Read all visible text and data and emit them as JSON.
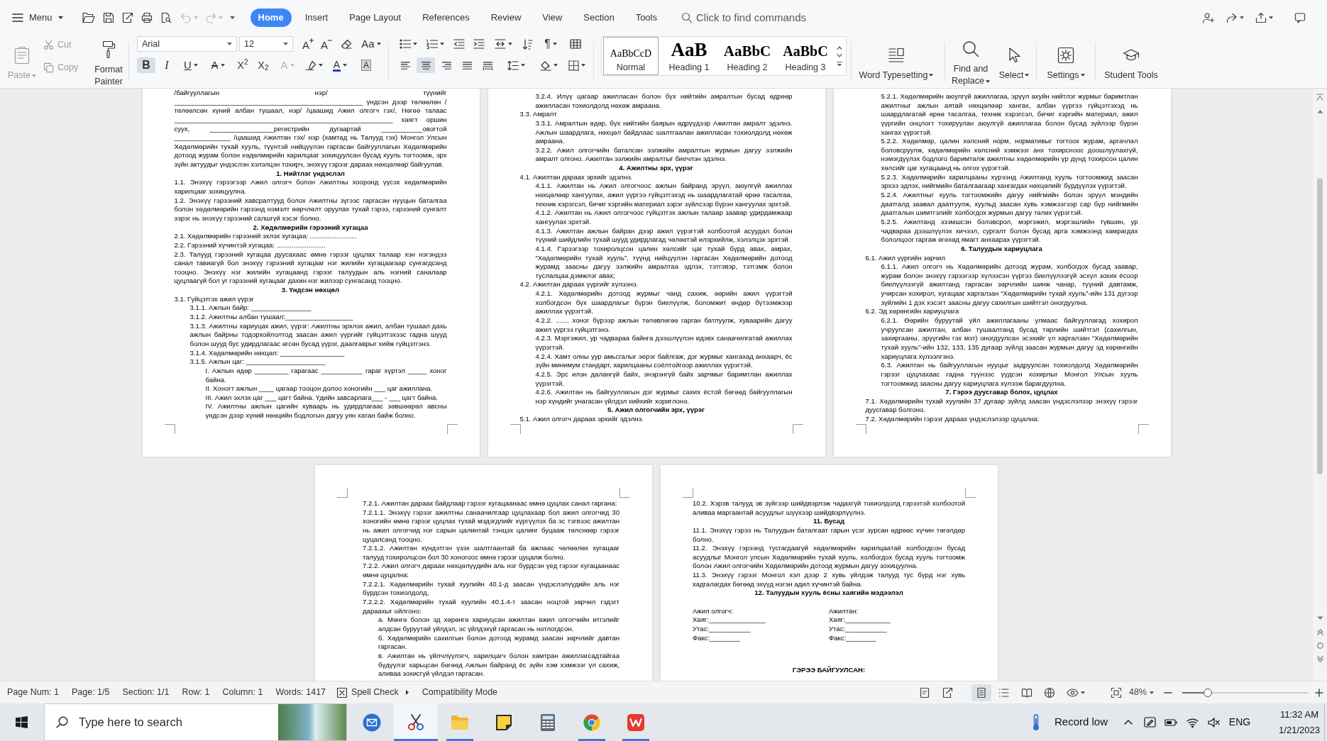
{
  "title_bar": {
    "menu": "Menu",
    "history": [
      {
        "kind": "undo",
        "disabled": true
      },
      {
        "kind": "redo",
        "disabled": true
      }
    ],
    "tabs": [
      {
        "label": "Home",
        "selected": true
      },
      {
        "label": "Insert",
        "selected": false
      },
      {
        "label": "Page Layout",
        "selected": false
      },
      {
        "label": "References",
        "selected": false
      },
      {
        "label": "Review",
        "selected": false
      },
      {
        "label": "View",
        "selected": false
      },
      {
        "label": "Section",
        "selected": false
      },
      {
        "label": "Tools",
        "selected": false
      }
    ],
    "search": {
      "placeholder": "Click to find commands"
    }
  },
  "ribbon": {
    "clipboard": [
      {
        "kind": "paste",
        "label": "Paste",
        "disabled": true
      },
      {
        "kind": "cut",
        "label": "Cut",
        "disabled": true
      },
      {
        "kind": "copy",
        "label": "Copy",
        "disabled": true
      },
      {
        "kind": "format_painter",
        "label": "Format Painter",
        "disabled": false
      }
    ],
    "font": {
      "family": "Arial",
      "size": "12",
      "tools": [
        {
          "kind": "grow",
          "glyph": "A"
        },
        {
          "kind": "shrink",
          "glyph": "A"
        },
        {
          "kind": "clear"
        },
        {
          "kind": "change_case",
          "glyph": "Aa"
        }
      ],
      "toggles": [
        {
          "kind": "bold",
          "glyph": "B",
          "selected": true
        },
        {
          "kind": "italic",
          "glyph": "I",
          "selected": false
        },
        {
          "kind": "underline",
          "glyph": "U",
          "selected": false
        },
        {
          "kind": "strikethrough",
          "glyph": "A",
          "selected": false
        },
        {
          "kind": "superscript",
          "glyph": "X$^{2}$",
          "selected": false
        },
        {
          "kind": "subscript",
          "glyph": "X$_{2}$",
          "selected": false
        }
      ],
      "effects": [
        {
          "kind": "text_effect",
          "glyph": "A",
          "disabled": true
        },
        {
          "kind": "highlight",
          "disabled": false
        },
        {
          "kind": "font_color",
          "glyph": "A",
          "disabled": false
        },
        {
          "kind": "character_shading",
          "glyph": "A",
          "disabled": false
        }
      ]
    },
    "paragraph": {
      "marks_glyph": "¶",
      "alignment": [
        {
          "selected": false
        },
        {
          "selected": true
        },
        {
          "selected": false
        },
        {
          "selected": false
        },
        {
          "selected": false
        }
      ]
    },
    "styles": [
      {
        "kind": "normal",
        "preview": "AaBbCcD",
        "label": "Normal",
        "selected": true
      },
      {
        "kind": "heading1",
        "preview": "AaB",
        "label": "Heading 1",
        "selected": false
      },
      {
        "kind": "heading2",
        "preview": "AaBbC",
        "label": "Heading 2",
        "selected": false
      },
      {
        "kind": "heading3",
        "preview": "AaBbC",
        "label": "Heading 3",
        "selected": false
      }
    ],
    "tools": [
      {
        "kind": "typesetting",
        "label": "Word Typesetting",
        "dropdown": true
      },
      {
        "kind": "find",
        "label": "Find and Replace",
        "dropdown": true
      },
      {
        "kind": "select",
        "label": "Select",
        "dropdown": true
      },
      {
        "kind": "settings",
        "label": "Settings",
        "dropdown": true
      },
      {
        "kind": "student",
        "label": "Student Tools",
        "dropdown": false
      }
    ]
  },
  "document": {
    "pages": [
      {
        "blocks": [
          {
            "kind": "paragraph",
            "text": "/байгууллагын нэр/ түүнийг __________________________________________________ үндсэн дээр төлөөлөн /төлөөлсөн хүний албан тушаал, нэр/ /цаашид Ажил олгогч гэх/, Нөгөө талаас __________________________________________________________ хаягт оршин суух, _________________регистрийн дугаартай ___________овогтой _______________ /цаашид Ажилтан гэх/ нэр (хамтад нь Талууд гэх) Монгол Улсын Хөдөлмөрийн тухай хууль, түүнтэй нийцүүлэн гаргасан байгууллагын Хөдөлмөрийн дотоод журам болон хөдөлмөрийн харилцааг зохицуулсан бусад хууль тогтоомж, эрх зүйн актуудыг үндэслэн хэлэлцэн тохирч, энэхүү гэрээг дараах нөхцөлөөр байгуулав."
          },
          {
            "kind": "heading",
            "text": "1. Нийтлэг үндэслэл"
          },
          {
            "kind": "paragraph",
            "text": "1.1. Энэхүү гэрээгээр Ажил олгогч болон Ажилтны хооронд үүсэх хөдөлмөрийн харилцааг зохицуулна."
          },
          {
            "kind": "paragraph",
            "text": "1.2. Энэхүү гэрээний хавсралтууд болох Ажилтны зүгээс гаргасан нууцын баталгаа болон хөдөлмөрийн гэрээнд нэмэлт өөрчлөлт оруулах тухай гэрээ, гэрээний сунгалт зэрэг нь энэхүү гэрээний салшгүй хэсэг болно."
          },
          {
            "kind": "heading",
            "text": "2. Хөдөлмөрийн гэрээний хугацаа"
          },
          {
            "kind": "paragraph",
            "text": "2.1. Хөдөлмөрийн гэрээний эхлэх хугацаа: ........................."
          },
          {
            "kind": "paragraph",
            "text": "2.2. Гэрээний хүчинтэй хугацаа: .........................."
          },
          {
            "kind": "paragraph",
            "text": "2.3. Талууд гэрээний хугацаа дуусахаас өмнө гэрээг цуцлах талаар хэн нэгэндээ санал тавиагүй бол энэхүү гэрээний хугацааг нэг жилийн хугацаагаар сунгагдсанд тооцно. Энэхүү нэг жилийн хугацаанд гэрээг талуудын аль нэгний саналаар цуцлаагүй бол уг гэрээний хугацааг дахин нэг жилээр сунгасанд тооцно."
          },
          {
            "kind": "heading",
            "text": "3. Үндсэн нөхцөл"
          },
          {
            "kind": "paragraph",
            "text": "3.1. Гүйцэтгэх ажил үүрэг",
            "children": [
              {
                "kind": "paragraph",
                "text": "3.1.1. Ажлын байр: ________________"
              },
              {
                "kind": "paragraph",
                "text": "3.1.2. Ажилтны албан тушаал:__________________"
              },
              {
                "kind": "paragraph",
                "text": "3.1.3. Ажилтны хариуцах ажил, үүрэг: Ажилтны эрхлэх ажил, албан тушаал дахь ажлын байрны тодорхойлолтод заасан ажил үүргийг гүйцэтгэхээс гадна шууд болон шууд бус удирдлагаас өгсөн бусад үүрэг, даалгаврыг хийж гүйцэтгэнэ."
              },
              {
                "kind": "paragraph",
                "text": "3.1.4. Хөдөлмөрийн нөхцөл: _________________"
              },
              {
                "kind": "paragraph",
                "text": "3.1.5. Ажлын цаг: _____________________",
                "children": [
                  {
                    "kind": "paragraph",
                    "text": "I. Ажлын өдөр _________ гарагаас ___________ гараг хүртэл _____ хоног байна."
                  },
                  {
                    "kind": "paragraph",
                    "text": "II. Хоногт ажлын ____ цагаар тооцон долоо хоногийн ___ цаг ажиллана."
                  },
                  {
                    "kind": "paragraph",
                    "text": "III. Ажил эхлэх цаг ___ цагт байна. Үдийн завсарлага___ - ___ цагт байна."
                  },
                  {
                    "kind": "paragraph",
                    "text": "IV. Ажилтны ажлын цагийн хуваарь нь удирдлагаас зөвшөөрөл авсны үндсэн дээр хүний нөөцийн бодлогын дагуу уян хатан байж болно."
                  }
                ]
              }
            ]
          }
        ]
      },
      {
        "blocks": [
          {
            "kind": "paragraph",
            "children": [
              {
                "kind": "paragraph",
                "text": "3.2.4. Илүү цагаар ажилласан болон бүх нийтийн амралтын бусад өдрөөр ажилласан тохиолдолд нөхөж амраана."
              }
            ]
          },
          {
            "kind": "paragraph",
            "text": "3.3. Амралт",
            "children": [
              {
                "kind": "paragraph",
                "text": "3.3.1. Амралтын өдөр, бүх нийтийн баярын өдрүүдээр Ажилтан амралт эдэлнэ. Ажлын шаардлага, нөхцөл байдлаас шалтгаалан ажилласан тохиолдолд нөхөж амраана."
              },
              {
                "kind": "paragraph",
                "text": "3.2.2. Ажил олгогчийн баталсан ээлжийн амралтын журмын дагуу ээлжийн амралт олгоно. Ажилтан ээлжийн амралтыг биечлэн эдэлнэ."
              }
            ]
          },
          {
            "kind": "heading",
            "text": "4. Ажилтны эрх, үүрэг"
          },
          {
            "kind": "paragraph",
            "text": "4.1. Ажилтан дараах эрхийг эдэлнэ.",
            "children": [
              {
                "kind": "paragraph",
                "text": "4.1.1. Ажилтан нь Ажил олгогчоос ажлын байранд эрүүл, аюулгүй ажиллах нөхцөлөөр хангуулах, ажил үүргээ гүйцэтгэхэд нь шаардлагатай өрөө тасалгаа, техник хэрэгсэл, бичиг хэргийн материал зэрэг зүйлсээр бүрэн хангуулах эрхтэй."
              },
              {
                "kind": "paragraph",
                "text": "4.1.2. Ажилтан нь Ажил олгогчоос гүйцэтгэх ажлын талаар заавар удирдамжаар хангуулах эрхтэй."
              },
              {
                "kind": "paragraph",
                "text": "4.1.3. Ажилтан ажлын байран дээр ажил үүрэгтэй холбоотой асуудал болон түүний шийдлийн тухай шууд удирдлагад чөлөөтэй илэрхийлж, хэлэлцэх эрхтэй."
              },
              {
                "kind": "paragraph",
                "text": "4.1.4. Гэрээгээр тохиролцсон цалин хөлсийг цаг тухай бүрд авах, амрах, “Хөдөлмөрийн тухай хууль”, түүнд нийцүүлэн гаргасан Хөдөлмөрийн дотоод журамд заасны дагуу ээлжийн амралтаа эдлэх, тэтгэвэр, тэтгэмж болон туслалцаа дэмжлэг авах;"
              }
            ]
          },
          {
            "kind": "paragraph",
            "text": "4.2. Ажилтан дараах үүргийг хүлээнэ.",
            "children": [
              {
                "kind": "paragraph",
                "text": "4.2.1. Хөдөлмөрийн дотоод журмыг чанд сахиж, өөрийн ажил үүрэгтэй холбогдсон бүх шаардлагыг бүрэн биелүүлж, боломжит өндөр бүтээмжээр ажиллах үүрэгтэй."
              },
              {
                "kind": "paragraph",
                "text": "4.2.2. ....... хоног бүрээр ажлын төлөвлөгөө гарган батлуулж, хуваарийн дагуу ажил үүргээ гүйцэтгэнэ."
              },
              {
                "kind": "paragraph",
                "text": "4.2.3. Мэргэжил, ур чадвараа байнга дээшлүүлэн идэвх санаачилгатай ажиллах үүрэгтэй."
              },
              {
                "kind": "paragraph",
                "text": "4.2.4. Хамт олны уур амьсгалыг эерэг байлгаж, дэг журмыг хангахад анхаарч, ёс зүйн минимум стандарт, харилцааны соёлтойгоор ажиллах үүрэгтэй."
              },
              {
                "kind": "paragraph",
                "text": "4.2.5. Эрс илэн далангүй байх, энэрэнгүй байх зарчмыг баримтлан ажиллах үүрэгтэй."
              },
              {
                "kind": "paragraph",
                "text": "4.2.6. Ажилтан нь байгууллагын дэг журмыг сахих ёстой бөгөөд байгууллагын нэр хүндийг унагасан үйлдэл хийхийг хориглоно."
              }
            ]
          },
          {
            "kind": "heading",
            "text": "5. Ажил олгогчийн эрх, үүрэг"
          },
          {
            "kind": "paragraph",
            "text": "5.1. Ажил олгогч дараах эрхийг эдэлнэ."
          }
        ]
      },
      {
        "blocks": [
          {
            "kind": "paragraph",
            "children": [
              {
                "kind": "paragraph",
                "text": "5.2.1. Хөдөлмөрийн аюулгүй ажиллагаа, эрүүл ахуйн нийтлэг журмыг баримтлан ажилтныг ажлын аятай нөхцөлөөр хангах, албан үүргээ гүйцэтгэхэд нь шаардлагатай өрөө тасалгаа, техник хэрэгсэл, бичиг хэргийн материал, ажил үүргийн онцлогт тохируулан аюулгүй ажиллагаа болон бусад зүйлээр бүрэн хангах үүрэгтэй."
              },
              {
                "kind": "paragraph",
                "text": "5.2.2. Хөдөлмөр, цалин хөлсний норм, нормативыг тогтоох журам, аргачлал боловсруулж, хөдөлмөрийн хөлсний хэмжээг анх тохирсноос доошлуулахгүй, нэмэгдүүлэх бодлого баримталж ажилтны хөдөлмөрийн үр дүнд тохирсон цалин хөлсийг цаг хугацаанд нь олгох үүрэгтэй."
              },
              {
                "kind": "paragraph",
                "text": "5.2.3. Хөдөлмөрийн харилцааны хүрээнд Ажилтанд хууль тогтоомжид заасан эрхээ эдлэх, нийгмийн баталгаагаар хангагдах нөхцөлийг бүрдүүлэх үүрэгтэй."
              },
              {
                "kind": "paragraph",
                "text": "5.2.4. Ажилтныг хууль тогтоомжийн дагуу нийгмийн болон эрүүл мэндийн даатгалд заавал даатгуулж, хуульд заасан хувь хэмжээгээр сар бүр нийгмийн даатгалын шимтгэлийг холбогдох журмын дагуу төлөх үүрэгтэй."
              },
              {
                "kind": "paragraph",
                "text": "5.2.5. Ажилтанд эзэмшсэн боловсрол, мэргэжил, мэргэшлийн түвшин, ур чадвараа дээшлүүлэх хичээл, сургалт болон бусад арга хэмжээнд хамрагдах бололцоог гаргаж өгөхөд ямагт анхаарах үүрэгтэй."
              }
            ]
          },
          {
            "kind": "heading",
            "text": "6. Талуудын хариуцлага"
          },
          {
            "kind": "paragraph",
            "text": "6.1. Ажил үүргийн зөрчил",
            "children": [
              {
                "kind": "paragraph",
                "text": "6.1.1. Ажил олгогч нь Хөдөлмөрийн дотоод журам, холбогдох бусад заавар, журам болон энэхүү гэрээгээр хүлээсэн үүргээ биелүүлээгүй эсхүл зохих ёсоор биелүүлээгүй ажилтанд гаргасан зөрчлийн шинж чанар, түүний давтамж, учирсан хохирол, хугацааг харгалзан “Хөдөлмөрийн тухай хууль”-ийн 131 дүгээр зүйлийн 1 дэх хэсэгт заасны дагуу сахилгын шийтгэл оногдуулна."
              }
            ]
          },
          {
            "kind": "paragraph",
            "text": "6.2. Эд хөрөнгийн хариуцлага",
            "children": [
              {
                "kind": "paragraph",
                "text": "6.2.1. Өөрийн буруутай үйл ажиллагааны улмаас байгууллагад хохирол учруулсан ажилтан, албан тушаалтанд бусад төрлийн шийтгэл (сахилгын, захиргааны, эрүүгийн гэх мэт) оногдуулсан эсэхийг үл харгалзан “Хөдөлмөрийн тухай хууль”-ийн 132, 133, 135 дугаар зүйлд заасан журмын дагуу эд хөрөнгийн хариуцлага хүлээлгэнэ."
              },
              {
                "kind": "paragraph",
                "text": "6.3. Ажилтан нь байгууллагын нууцыг задруулсан тохиолдолд Хөдөлмөрийн гэрээг цуцлахаас гадна түүнээс үүдсэн хохирлыг Монгол Улсын хууль тогтоомжид заасны дагуу хариуцлага хүлээж барагдуулна."
              }
            ]
          },
          {
            "kind": "heading",
            "text": "7. Гэрээ дуусгавар болох, цуцлах"
          },
          {
            "kind": "paragraph",
            "text": "7.1. Хөдөлмөрийн тухай хуулийн 37 дугаар зүйлд заасан үндэслэлээр энэхүү гэрээг дуусгавар болгоно."
          },
          {
            "kind": "paragraph",
            "text": "7.2. Хөдөлмөрийн гэрээг дараах үндэслэлээр цуцална:"
          }
        ]
      },
      {
        "blocks": [
          {
            "kind": "paragraph",
            "children": [
              {
                "kind": "paragraph",
                "text": "7.2.1. Ажилтан дараах байдлаар гэрээг хугацаанаас өмнө цуцлах санал гаргана:"
              },
              {
                "kind": "paragraph",
                "text": "7.2.1.1. Энэхүү гэрээг ажилтны санаачилгаар цуцлахаар бол ажил олгогчид 30 хоногийн өмнө гэрээг цуцлах тухай мэдэгдлийг хүргүүлэх ба эс тэгвээс ажилтан нь ажил олгогчид нэг сарын цалинтай тэнцэх цалинг буцааж төлснөөр гэрээг цуцалсанд тооцно."
              },
              {
                "kind": "paragraph",
                "text": "7.2.1.2. Ажилтан хүндэтгэн үзэх шалтгаантай ба ажлаас чөлөөлөх хугацааг талууд тохиролцсон бол 30 хоногоос өмнө гэрээг цуцалж болно."
              },
              {
                "kind": "paragraph",
                "text": "7.2.2. Ажил олгогч дараах нөхцөлүүдийн аль нэг бүрдсэн үед гэрээг хугацаанаас өмнө цуцална:"
              },
              {
                "kind": "paragraph",
                "text": "7.2.2.1. Хөдөлмөрийн тухай хуулийн 40.1-д заасан үндэслэлүүдийн аль нэг бүрдсэн тохиолдолд,"
              },
              {
                "kind": "paragraph",
                "text": "7.2.2.2. Хөдөлмөрийн тухай хуулийн 40.1.4-т заасан ноцтой зөрчил гэдэгт дараахыг ойлгоно:",
                "children": [
                  {
                    "kind": "paragraph",
                    "text": "а. Мөнгө болон эд хөрөнгө хариуцсан ажилтан ажил олгогчийн итгэлийг алдсан буруутай үйлдэл, эс үйлдэхүй гаргасан нь нотлогдсон."
                  },
                  {
                    "kind": "paragraph",
                    "text": "б. Хөдөлмөрийн сахилгын болон дотоод журамд заасан зөрчлийг давтан гаргасан."
                  },
                  {
                    "kind": "paragraph",
                    "text": "в. Ажилтан нь үйлчлүүлэгч, харилцагч болон хамтран ажиллагсадтайгаа бүдүүлэг харьцсан бөгөөд Ажлын байранд ёс зүйн хэм хэмжээг үл сахиж, аливаа зохисгүй үйлдэл гаргасан."
                  }
                ]
              }
            ]
          }
        ]
      },
      {
        "blocks": [
          {
            "kind": "paragraph",
            "text": "10.2. Хэрэв талууд эв зүйгээр шийдвэрлэж чадахгүй тохиолдолд гэрээтэй холбоотой аливаа маргаантай асуудлыг шүүхээр шийдвэрлүүлнэ."
          },
          {
            "kind": "heading",
            "text": "11. Бусад"
          },
          {
            "kind": "paragraph",
            "text": "11.1. Энэхүү гэрээ нь Талуудын баталгаат гарын үсэг зурсан өдрөөс хүчин төгөлдөр болно."
          },
          {
            "kind": "paragraph",
            "text": "11.2. Энэхүү гэрээнд тусгагдаагүй хөдөлмөрийн харилцаатай холбогдсон бусад асуудлыг Монгол улсын Хөдөлмөрийн тухай хууль, холбогдох бусад хууль тогтоомж болон Ажил олгогчийн Хөдөлмөрийн дотоод журмын дагуу зохицуулна."
          },
          {
            "kind": "paragraph",
            "text": "11.3. Энэхүү гэрээг Монгол хэл дээр 2 хувь үйлдэж талууд тус бүрд нэг хувь хадгалагдах бөгөөд эхүүд нэгэн адил хүчинтэй байна."
          },
          {
            "kind": "heading",
            "text": "12. Талуудын хууль ёсны хаягийн мэдээлэл"
          },
          {
            "kind": "contacts",
            "columns": [
              {
                "title": "Ажил олгогч:",
                "lines": [
                  "Хаяг:_______________",
                  "Утас:___________",
                  "Факс:________"
                ]
              },
              {
                "title": "Ажилтан:",
                "lines": [
                  "Хаяг:____________",
                  "Утас:___________",
                  "Факс:________"
                ]
              }
            ]
          },
          {
            "kind": "signature",
            "text": "ГЭРЭЭ БАЙГУУЛСАН:"
          }
        ]
      }
    ]
  },
  "status_bar": {
    "fields": [
      "Page Num: 1",
      "Page: 1/5",
      "Section: 1/1",
      "Row: 1",
      "Column: 1",
      "Words: 1417"
    ],
    "spell_check": "Spell Check",
    "mode": "Compatibility Mode",
    "view_modes": [
      {
        "selected": true
      },
      {
        "selected": false
      },
      {
        "selected": false
      },
      {
        "selected": false
      }
    ],
    "zoom": {
      "reading": "48%",
      "level": 0.2
    }
  },
  "taskbar": {
    "search": {
      "placeholder": "Type here to search"
    },
    "apps": [
      {
        "kind": "mail",
        "running": false,
        "selected": false
      },
      {
        "kind": "snipping",
        "running": true,
        "selected": true
      },
      {
        "kind": "files",
        "running": true,
        "selected": false
      },
      {
        "kind": "notes",
        "running": false,
        "selected": false
      },
      {
        "kind": "calculator",
        "running": false,
        "selected": false
      },
      {
        "kind": "browser",
        "running": true,
        "selected": false
      },
      {
        "kind": "office",
        "running": true,
        "selected": false
      }
    ],
    "weather": "Record low",
    "language": "ENG",
    "time": "11:32 AM",
    "date": "1/21/2023"
  }
}
